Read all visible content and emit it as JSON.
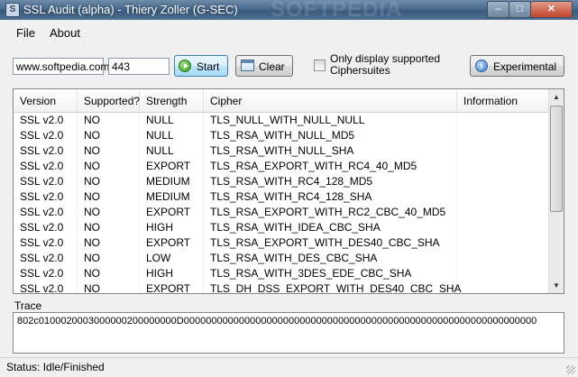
{
  "window": {
    "title": "SSL Audit (alpha)  - Thiery Zoller (G-SEC)",
    "watermark": "SOFTPEDIA",
    "controls": {
      "minimize": "–",
      "maximize": "□",
      "close": "✕"
    }
  },
  "menu": {
    "items": [
      "File",
      "About"
    ]
  },
  "toolbar": {
    "host_value": "www.softpedia.com",
    "port_value": "443",
    "start_label": "Start",
    "clear_label": "Clear",
    "only_supported_label_line1": "Only display supported",
    "only_supported_label_line2": "Ciphersuites",
    "only_supported_checked": false,
    "experimental_label": "Experimental"
  },
  "table": {
    "columns": [
      "Version",
      "Supported?",
      "Strength",
      "Cipher",
      "Information"
    ],
    "rows": [
      [
        "SSL v2.0",
        "NO",
        "NULL",
        "TLS_NULL_WITH_NULL_NULL",
        ""
      ],
      [
        "SSL v2.0",
        "NO",
        "NULL",
        "TLS_RSA_WITH_NULL_MD5",
        ""
      ],
      [
        "SSL v2.0",
        "NO",
        "NULL",
        "TLS_RSA_WITH_NULL_SHA",
        ""
      ],
      [
        "SSL v2.0",
        "NO",
        "EXPORT",
        "TLS_RSA_EXPORT_WITH_RC4_40_MD5",
        ""
      ],
      [
        "SSL v2.0",
        "NO",
        "MEDIUM",
        "TLS_RSA_WITH_RC4_128_MD5",
        ""
      ],
      [
        "SSL v2.0",
        "NO",
        "MEDIUM",
        "TLS_RSA_WITH_RC4_128_SHA",
        ""
      ],
      [
        "SSL v2.0",
        "NO",
        "EXPORT",
        "TLS_RSA_EXPORT_WITH_RC2_CBC_40_MD5",
        ""
      ],
      [
        "SSL v2.0",
        "NO",
        "HIGH",
        "TLS_RSA_WITH_IDEA_CBC_SHA",
        ""
      ],
      [
        "SSL v2.0",
        "NO",
        "EXPORT",
        "TLS_RSA_EXPORT_WITH_DES40_CBC_SHA",
        ""
      ],
      [
        "SSL v2.0",
        "NO",
        "LOW",
        "TLS_RSA_WITH_DES_CBC_SHA",
        ""
      ],
      [
        "SSL v2.0",
        "NO",
        "HIGH",
        "TLS_RSA_WITH_3DES_EDE_CBC_SHA",
        ""
      ],
      [
        "SSL v2.0",
        "NO",
        "EXPORT",
        "TLS_DH_DSS_EXPORT_WITH_DES40_CBC_SHA",
        ""
      ]
    ]
  },
  "trace": {
    "label": "Trace",
    "value": "802c0100020003000000200000000D0000000000000000000000000000000000000000000000000000000000000000"
  },
  "status": {
    "text": "Status: Idle/Finished"
  }
}
